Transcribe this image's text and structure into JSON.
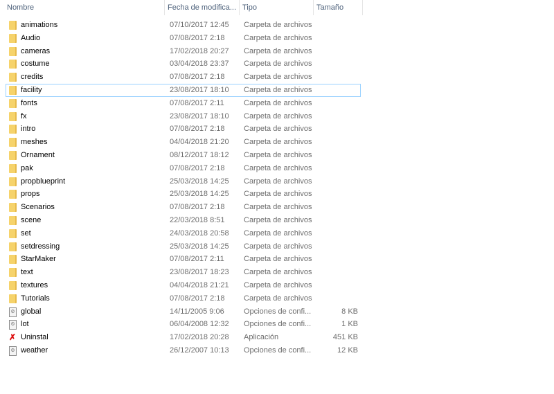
{
  "columns": {
    "name": "Nombre",
    "date": "Fecha de modifica...",
    "type": "Tipo",
    "size": "Tamaño"
  },
  "selected": "facility",
  "files": [
    {
      "name": "animations",
      "date": "07/10/2017 12:45",
      "type": "Carpeta de archivos",
      "size": "",
      "icon": "folder"
    },
    {
      "name": "Audio",
      "date": "07/08/2017 2:18",
      "type": "Carpeta de archivos",
      "size": "",
      "icon": "folder"
    },
    {
      "name": "cameras",
      "date": "17/02/2018 20:27",
      "type": "Carpeta de archivos",
      "size": "",
      "icon": "folder"
    },
    {
      "name": "costume",
      "date": "03/04/2018 23:37",
      "type": "Carpeta de archivos",
      "size": "",
      "icon": "folder"
    },
    {
      "name": "credits",
      "date": "07/08/2017 2:18",
      "type": "Carpeta de archivos",
      "size": "",
      "icon": "folder"
    },
    {
      "name": "facility",
      "date": "23/08/2017 18:10",
      "type": "Carpeta de archivos",
      "size": "",
      "icon": "folder"
    },
    {
      "name": "fonts",
      "date": "07/08/2017 2:11",
      "type": "Carpeta de archivos",
      "size": "",
      "icon": "folder"
    },
    {
      "name": "fx",
      "date": "23/08/2017 18:10",
      "type": "Carpeta de archivos",
      "size": "",
      "icon": "folder"
    },
    {
      "name": "intro",
      "date": "07/08/2017 2:18",
      "type": "Carpeta de archivos",
      "size": "",
      "icon": "folder"
    },
    {
      "name": "meshes",
      "date": "04/04/2018 21:20",
      "type": "Carpeta de archivos",
      "size": "",
      "icon": "folder"
    },
    {
      "name": "Ornament",
      "date": "08/12/2017 18:12",
      "type": "Carpeta de archivos",
      "size": "",
      "icon": "folder"
    },
    {
      "name": "pak",
      "date": "07/08/2017 2:18",
      "type": "Carpeta de archivos",
      "size": "",
      "icon": "folder"
    },
    {
      "name": "propblueprint",
      "date": "25/03/2018 14:25",
      "type": "Carpeta de archivos",
      "size": "",
      "icon": "folder"
    },
    {
      "name": "props",
      "date": "25/03/2018 14:25",
      "type": "Carpeta de archivos",
      "size": "",
      "icon": "folder"
    },
    {
      "name": "Scenarios",
      "date": "07/08/2017 2:18",
      "type": "Carpeta de archivos",
      "size": "",
      "icon": "folder"
    },
    {
      "name": "scene",
      "date": "22/03/2018 8:51",
      "type": "Carpeta de archivos",
      "size": "",
      "icon": "folder"
    },
    {
      "name": "set",
      "date": "24/03/2018 20:58",
      "type": "Carpeta de archivos",
      "size": "",
      "icon": "folder"
    },
    {
      "name": "setdressing",
      "date": "25/03/2018 14:25",
      "type": "Carpeta de archivos",
      "size": "",
      "icon": "folder"
    },
    {
      "name": "StarMaker",
      "date": "07/08/2017 2:11",
      "type": "Carpeta de archivos",
      "size": "",
      "icon": "folder"
    },
    {
      "name": "text",
      "date": "23/08/2017 18:23",
      "type": "Carpeta de archivos",
      "size": "",
      "icon": "folder"
    },
    {
      "name": "textures",
      "date": "04/04/2018 21:21",
      "type": "Carpeta de archivos",
      "size": "",
      "icon": "folder"
    },
    {
      "name": "Tutorials",
      "date": "07/08/2017 2:18",
      "type": "Carpeta de archivos",
      "size": "",
      "icon": "folder"
    },
    {
      "name": "global",
      "date": "14/11/2005 9:06",
      "type": "Opciones de confi...",
      "size": "8 KB",
      "icon": "config-file"
    },
    {
      "name": "lot",
      "date": "06/04/2008 12:32",
      "type": "Opciones de confi...",
      "size": "1 KB",
      "icon": "config-file"
    },
    {
      "name": "Uninstal",
      "date": "17/02/2018 20:28",
      "type": "Aplicación",
      "size": "451 KB",
      "icon": "uninstall-app"
    },
    {
      "name": "weather",
      "date": "26/12/2007 10:13",
      "type": "Opciones de confi...",
      "size": "12 KB",
      "icon": "config-file"
    }
  ]
}
